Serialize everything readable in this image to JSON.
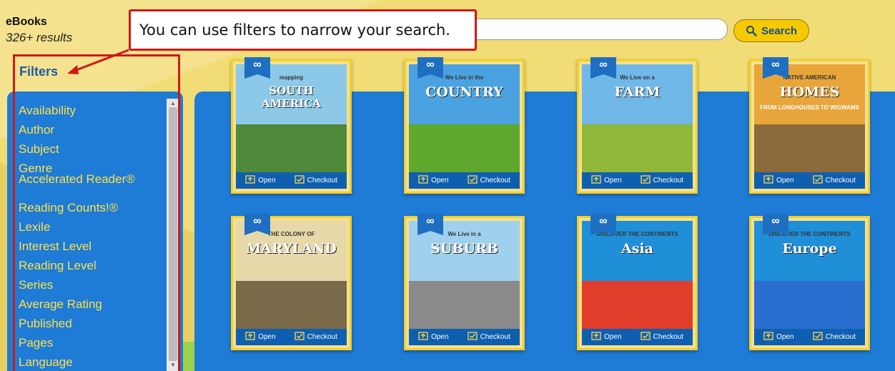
{
  "header": {
    "title": "eBooks",
    "count": "326+ results"
  },
  "search": {
    "button_label": "Search",
    "placeholder": ""
  },
  "callout": {
    "text": "You can use filters to narrow your search."
  },
  "filters": {
    "heading": "Filters",
    "items": [
      "Availability",
      "Author",
      "Subject",
      "Genre",
      "Accelerated Reader®",
      "Reading Counts!®",
      "Lexile",
      "Interest Level",
      "Reading Level",
      "Series",
      "Average Rating",
      "Published",
      "Pages",
      "Language"
    ]
  },
  "book_actions": {
    "open": "Open",
    "checkout": "Checkout",
    "unlimited_symbol": "∞"
  },
  "books": [
    {
      "cover_title": "SOUTH AMERICA",
      "cover_kicker": "mapping",
      "sky": "#8cc9e8",
      "ground": "#4e8a3a"
    },
    {
      "cover_title": "COUNTRY",
      "cover_kicker": "We Live in the",
      "sky": "#4aa3e0",
      "ground": "#5ea82e"
    },
    {
      "cover_title": "FARM",
      "cover_kicker": "We Live on a",
      "sky": "#6fb8e8",
      "ground": "#8fb83a"
    },
    {
      "cover_title": "HOMES",
      "cover_kicker": "NATIVE AMERICAN",
      "subline": "FROM LONGHOUSES TO WIGWAMS",
      "sky": "#e8a53a",
      "ground": "#8a6a3a"
    },
    {
      "cover_title": "MARYLAND",
      "cover_kicker": "THE COLONY OF",
      "sky": "#e6d8a8",
      "ground": "#7a6a4a"
    },
    {
      "cover_title": "SUBURB",
      "cover_kicker": "We Live in a",
      "sky": "#9fd0ee",
      "ground": "#8a8a8a"
    },
    {
      "cover_title": "Asia",
      "cover_kicker": "DISCOVER THE CONTINENTS",
      "sky": "#1f8fd8",
      "ground": "#e23c2a"
    },
    {
      "cover_title": "Europe",
      "cover_kicker": "DISCOVER THE CONTINENTS",
      "sky": "#1f8fd8",
      "ground": "#2a6fd0"
    }
  ],
  "colors": {
    "panel_blue": "#1e7bd6",
    "filter_text": "#ffe14a",
    "callout_border": "#cc1a1a",
    "search_button": "#f7c900"
  }
}
